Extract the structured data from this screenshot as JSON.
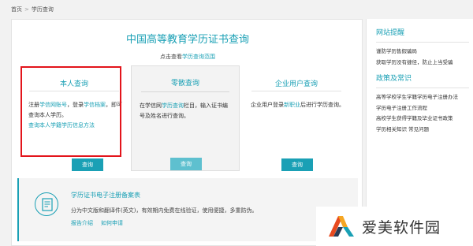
{
  "breadcrumb": {
    "home": "首页",
    "separator": ">",
    "current": "学历查询"
  },
  "page": {
    "title": "中国高等教育学历证书查询",
    "scope_prefix": "点击查看",
    "scope_link": "学历查询范围"
  },
  "cards": [
    {
      "title": "本人查询",
      "desc_parts": [
        "注册",
        "学信网账号",
        "，登录",
        "学信档案",
        "，即可查询本人学历。"
      ],
      "link2": "查询本人学籍学历信息方法",
      "button": "查询",
      "highlighted": true
    },
    {
      "title": "零散查询",
      "desc_parts": [
        "在学信网",
        "学历查询",
        "栏目，输入证书编号及姓名进行查询。"
      ],
      "button": "查询"
    },
    {
      "title": "企业用户查询",
      "desc_parts": [
        "企业用户登录",
        "新职业",
        "后进行学历查询。"
      ],
      "button": "查询"
    }
  ],
  "notice": {
    "title": "学历证书电子注册备案表",
    "description": "分为中文版和翻译件(英文)，有效期内免费在线验证，使用便捷，多重防伪。",
    "links": [
      "报告介绍",
      "如何申请"
    ],
    "icon": "document-icon"
  },
  "sidebar": {
    "sections": [
      {
        "heading": "网站提醒",
        "items": [
          "谨防学历售假骗局",
          "获取学历没有捷径，防止上当受骗"
        ]
      },
      {
        "heading": "政策及常识",
        "items": [
          "高等学校学生学籍学历电子注册办法",
          "学历电子注册工作流程",
          "高校学生获得学籍及毕业证书政策",
          "学历相关知识    常见问题"
        ]
      }
    ]
  },
  "watermark": {
    "text": "爱美软件园"
  },
  "colors": {
    "accent": "#1aa0b5",
    "highlight_border": "#e3141b",
    "background": "#f2f2f2"
  }
}
